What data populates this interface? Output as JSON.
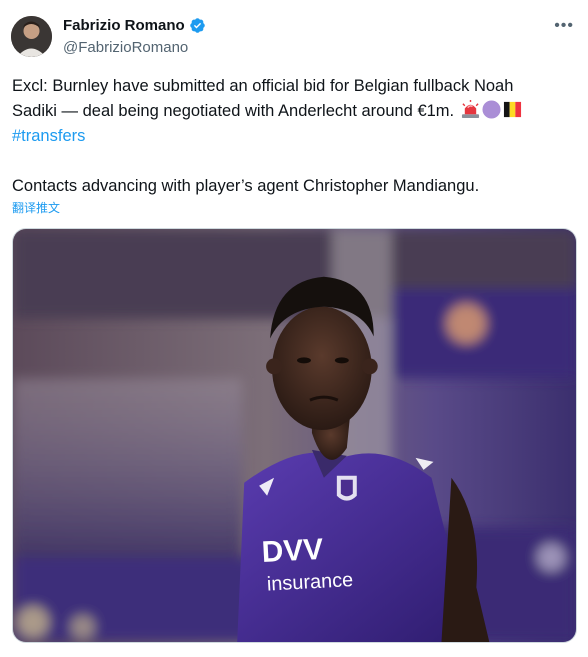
{
  "author": {
    "display_name": "Fabrizio Romano",
    "handle": "@FabrizioRomano",
    "avatar_icon": "avatar",
    "verified_icon": "verified-badge-icon"
  },
  "tweet": {
    "line1": "Excl: Burnley have submitted an official bid for Belgian fullback Noah",
    "line2": "Sadiki — deal being negotiated with Anderlecht around €1m.",
    "hashtag": "#transfers",
    "paragraph2": "Contacts advancing with player’s agent Christopher Mandiangu.",
    "translate_label": "翻译推文",
    "emojis": [
      "siren-emoji",
      "purple-circle-emoji",
      "belgium-flag-emoji"
    ]
  },
  "media": {
    "jersey_sponsor_top": "DVV",
    "jersey_sponsor_bottom": "insurance"
  },
  "more_icon": "more-options-icon",
  "colors": {
    "link": "#1d9bf0",
    "muted": "#536471",
    "jersey": "#4b2d8f"
  }
}
